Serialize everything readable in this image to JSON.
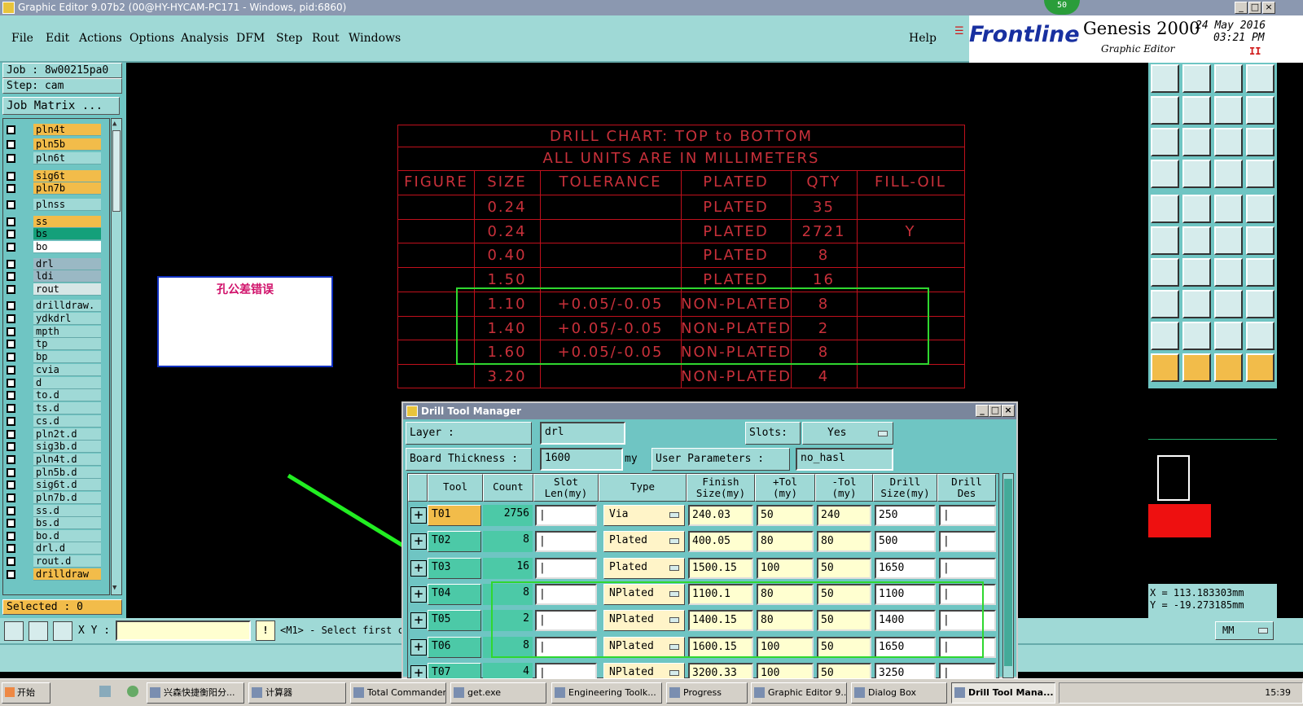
{
  "window": {
    "title": "Graphic Editor 9.07b2 (00@HY-HYCAM-PC171 - Windows, pid:6860)",
    "badge": "50"
  },
  "menu": {
    "items": [
      "File",
      "Edit",
      "Actions",
      "Options",
      "Analysis",
      "DFM",
      "Step",
      "Rout",
      "Windows"
    ],
    "help": "Help"
  },
  "brand": {
    "logo": "Frontline",
    "product": "Genesis 2000",
    "subtitle": "Graphic Editor",
    "date": "24 May 2016",
    "time": "03:21 PM",
    "pause": "II"
  },
  "job": {
    "job_label": "Job : 8w00215pa0",
    "step_label": "Step: cam",
    "matrix_button": "Job Matrix ..."
  },
  "layers": [
    {
      "name": "pln4t",
      "color": "#f2bc4a"
    },
    {
      "name": "pln5b",
      "color": "#f2bc4a"
    },
    {
      "name": "pln6t",
      "color": "#9fd9d6"
    },
    {
      "name": "sig6t",
      "color": "#f2bc4a"
    },
    {
      "name": "pln7b",
      "color": "#f2bc4a"
    },
    {
      "name": "plnss",
      "color": "#9fd9d6"
    },
    {
      "name": "ss",
      "color": "#f2bc4a"
    },
    {
      "name": "bs",
      "color": "#14a07a"
    },
    {
      "name": "bo",
      "color": "#ffffff"
    },
    {
      "name": "drl",
      "color": "#9ab8c4"
    },
    {
      "name": "ldi",
      "color": "#9ab8c4"
    },
    {
      "name": "rout",
      "color": "#d6e6e6"
    },
    {
      "name": "drilldraw.",
      "color": "#9fd9d6"
    },
    {
      "name": "ydkdrl",
      "color": "#9fd9d6"
    },
    {
      "name": "mpth",
      "color": "#9fd9d6"
    },
    {
      "name": "tp",
      "color": "#9fd9d6"
    },
    {
      "name": "bp",
      "color": "#9fd9d6"
    },
    {
      "name": "cvia",
      "color": "#9fd9d6"
    },
    {
      "name": "d",
      "color": "#9fd9d6"
    },
    {
      "name": "to.d",
      "color": "#9fd9d6"
    },
    {
      "name": "ts.d",
      "color": "#9fd9d6"
    },
    {
      "name": "cs.d",
      "color": "#9fd9d6"
    },
    {
      "name": "pln2t.d",
      "color": "#9fd9d6"
    },
    {
      "name": "sig3b.d",
      "color": "#9fd9d6"
    },
    {
      "name": "pln4t.d",
      "color": "#9fd9d6"
    },
    {
      "name": "pln5b.d",
      "color": "#9fd9d6"
    },
    {
      "name": "sig6t.d",
      "color": "#9fd9d6"
    },
    {
      "name": "pln7b.d",
      "color": "#9fd9d6"
    },
    {
      "name": "ss.d",
      "color": "#9fd9d6"
    },
    {
      "name": "bs.d",
      "color": "#9fd9d6"
    },
    {
      "name": "bo.d",
      "color": "#9fd9d6"
    },
    {
      "name": "drl.d",
      "color": "#9fd9d6"
    },
    {
      "name": "rout.d",
      "color": "#9fd9d6"
    },
    {
      "name": "drilldraw",
      "color": "#f2bc4a"
    }
  ],
  "selected": "Selected : 0",
  "drill_chart": {
    "title1": "DRILL CHART: TOP to BOTTOM",
    "title2": "ALL UNITS ARE IN MILLIMETERS",
    "headers": [
      "FIGURE",
      "SIZE",
      "TOLERANCE",
      "PLATED",
      "QTY",
      "FILL-OIL"
    ],
    "rows": [
      [
        "",
        "0.24",
        "",
        "PLATED",
        "35",
        ""
      ],
      [
        "",
        "0.24",
        "",
        "PLATED",
        "2721",
        "Y"
      ],
      [
        "",
        "0.40",
        "",
        "PLATED",
        "8",
        ""
      ],
      [
        "",
        "1.50",
        "",
        "PLATED",
        "16",
        ""
      ],
      [
        "",
        "1.10",
        "+0.05/-0.05",
        "NON-PLATED",
        "8",
        ""
      ],
      [
        "",
        "1.40",
        "+0.05/-0.05",
        "NON-PLATED",
        "2",
        ""
      ],
      [
        "",
        "1.60",
        "+0.05/-0.05",
        "NON-PLATED",
        "8",
        ""
      ],
      [
        "",
        "3.20",
        "",
        "NON-PLATED",
        "4",
        ""
      ]
    ]
  },
  "annotation": "孔公差错误",
  "coords": {
    "x": "X = 113.183303mm",
    "y": "Y = -19.273185mm"
  },
  "bottom": {
    "xy_label": "X Y :",
    "message": "<M1> - Select first co",
    "units": "MM"
  },
  "dtm": {
    "title": "Drill Tool Manager",
    "layer_label": "Layer :",
    "layer_value": "drl",
    "slots_label": "Slots:",
    "slots_value": "Yes",
    "thickness_label": "Board Thickness :",
    "thickness_value": "1600",
    "thickness_unit": "my",
    "userparam_label": "User Parameters :",
    "userparam_value": "no_hasl",
    "columns": [
      "Tool",
      "Count",
      "Slot\nLen(my)",
      "Type",
      "Finish\nSize(my)",
      "+Tol\n(my)",
      "-Tol\n(my)",
      "Drill\nSize(my)",
      "Drill\nDes"
    ],
    "rows": [
      {
        "tool": "T01",
        "count": "2756",
        "type": "Via",
        "finish": "240.03",
        "ptol": "50",
        "mtol": "240",
        "drill": "250"
      },
      {
        "tool": "T02",
        "count": "8",
        "type": "Plated",
        "finish": "400.05",
        "ptol": "80",
        "mtol": "80",
        "drill": "500"
      },
      {
        "tool": "T03",
        "count": "16",
        "type": "Plated",
        "finish": "1500.15",
        "ptol": "100",
        "mtol": "50",
        "drill": "1650"
      },
      {
        "tool": "T04",
        "count": "8",
        "type": "NPlated",
        "finish": "1100.1",
        "ptol": "80",
        "mtol": "50",
        "drill": "1100"
      },
      {
        "tool": "T05",
        "count": "2",
        "type": "NPlated",
        "finish": "1400.15",
        "ptol": "80",
        "mtol": "50",
        "drill": "1400"
      },
      {
        "tool": "T06",
        "count": "8",
        "type": "NPlated",
        "finish": "1600.15",
        "ptol": "100",
        "mtol": "50",
        "drill": "1650"
      },
      {
        "tool": "T07",
        "count": "4",
        "type": "NPlated",
        "finish": "3200.33",
        "ptol": "100",
        "mtol": "50",
        "drill": "3250"
      }
    ]
  },
  "taskbar": {
    "start": "开始",
    "items": [
      "兴森快捷衡阳分...",
      "计算器",
      "Total Commander...",
      "get.exe",
      "Engineering Toolk...",
      "Progress",
      "Graphic Editor 9....",
      "Dialog Box",
      "Drill Tool Mana..."
    ],
    "clock": "15:39"
  }
}
